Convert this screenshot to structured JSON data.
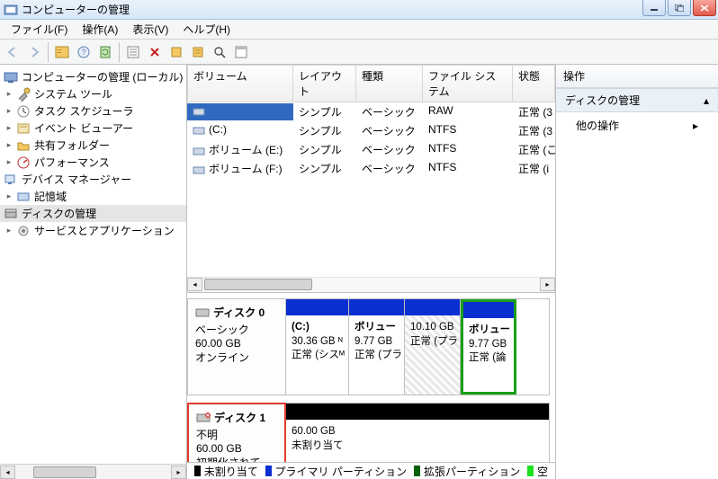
{
  "title": "コンピューターの管理",
  "menu": {
    "file": "ファイル(F)",
    "action": "操作(A)",
    "view": "表示(V)",
    "help": "ヘルプ(H)"
  },
  "tree": {
    "root": "コンピューターの管理 (ローカル)",
    "system_tools": "システム ツール",
    "task_scheduler": "タスク スケジューラ",
    "event_viewer": "イベント ビューアー",
    "shared_folders": "共有フォルダー",
    "performance": "パフォーマンス",
    "device_manager": "デバイス マネージャー",
    "storage": "記憶域",
    "disk_mgmt": "ディスクの管理",
    "services": "サービスとアプリケーション"
  },
  "vol_headers": {
    "volume": "ボリューム",
    "layout": "レイアウト",
    "type": "種類",
    "fs": "ファイル システム",
    "status": "状態"
  },
  "volumes": [
    {
      "name": "",
      "layout": "シンプル",
      "type": "ベーシック",
      "fs": "RAW",
      "status": "正常 (3"
    },
    {
      "name": "(C:)",
      "layout": "シンプル",
      "type": "ベーシック",
      "fs": "NTFS",
      "status": "正常 (3"
    },
    {
      "name": "ボリューム (E:)",
      "layout": "シンプル",
      "type": "ベーシック",
      "fs": "NTFS",
      "status": "正常 (こ"
    },
    {
      "name": "ボリューム (F:)",
      "layout": "シンプル",
      "type": "ベーシック",
      "fs": "NTFS",
      "status": "正常 (i"
    }
  ],
  "disk0": {
    "title": "ディスク 0",
    "type": "ベーシック",
    "size": "60.00 GB",
    "state": "オンライン",
    "parts": [
      {
        "name": "(C:)",
        "size": "30.36 GB ᴺ",
        "status": "正常 (シスᴹ",
        "hdr": "#0a2fd0",
        "w": 70
      },
      {
        "name": "ボリュー",
        "size": "9.77 GB",
        "status": "正常 (プラ",
        "hdr": "#0a2fd0",
        "w": 62
      },
      {
        "name": "",
        "size": "10.10 GB",
        "status": "正常 (プラ",
        "hdr": "#0a2fd0",
        "w": 62,
        "hatch": true
      },
      {
        "name": "ボリュー",
        "size": "9.77 GB",
        "status": "正常 (論",
        "hdr": "#0a2fd0",
        "w": 62,
        "green": true
      }
    ]
  },
  "disk1": {
    "title": "ディスク 1",
    "type": "不明",
    "size": "60.00 GB",
    "state": "初期化されて...",
    "summary_size": "60.00 GB",
    "summary_status": "未割り当て"
  },
  "legend": {
    "unalloc": "未割り当て",
    "primary": "プライマリ パーティション",
    "extended": "拡張パーティション",
    "free": "空"
  },
  "actions": {
    "header": "操作",
    "disk_mgmt": "ディスクの管理",
    "other": "他の操作"
  }
}
